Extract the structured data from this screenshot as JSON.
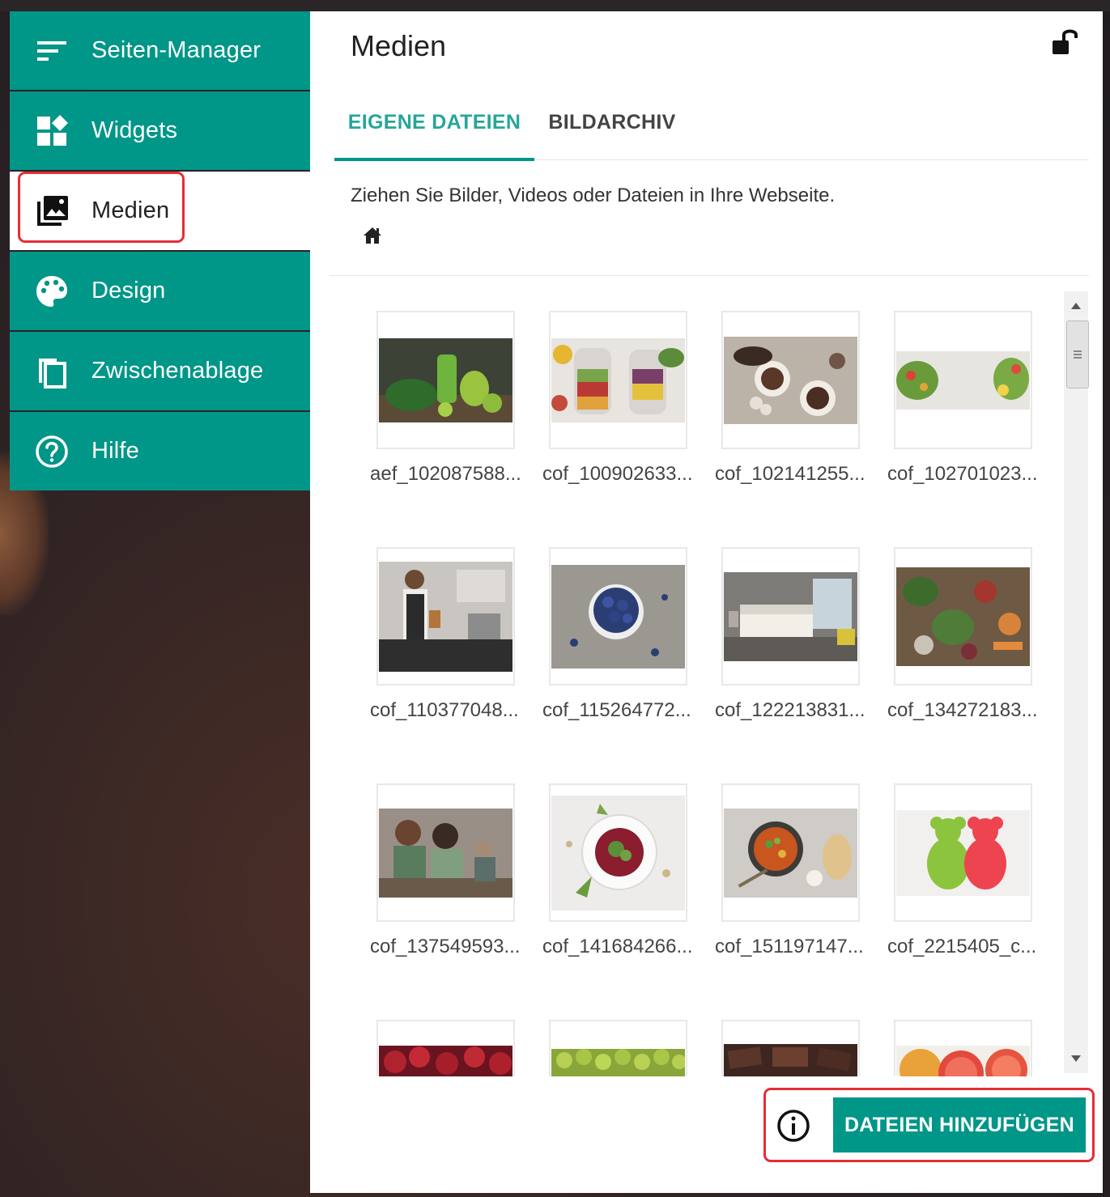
{
  "sidebar": {
    "items": [
      {
        "label": "Seiten-Manager",
        "icon": "sort-lines-icon"
      },
      {
        "label": "Widgets",
        "icon": "widgets-icon"
      },
      {
        "label": "Medien",
        "icon": "photo-library-icon",
        "active": true
      },
      {
        "label": "Design",
        "icon": "palette-icon"
      },
      {
        "label": "Zwischenablage",
        "icon": "copy-icon"
      },
      {
        "label": "Hilfe",
        "icon": "help-circle-icon"
      }
    ]
  },
  "panel": {
    "title": "Medien",
    "tabs": [
      {
        "label": "EIGENE DATEIEN",
        "active": true
      },
      {
        "label": "BILDARCHIV",
        "active": false
      }
    ],
    "hint": "Ziehen Sie Bilder, Videos oder Dateien in Ihre Webseite.",
    "add_button_label": "DATEIEN HINZUFÜGEN"
  },
  "media": [
    {
      "name": "aef_102087588..."
    },
    {
      "name": "cof_100902633..."
    },
    {
      "name": "cof_102141255..."
    },
    {
      "name": "cof_102701023..."
    },
    {
      "name": "cof_110377048..."
    },
    {
      "name": "cof_115264772..."
    },
    {
      "name": "cof_122213831..."
    },
    {
      "name": "cof_134272183..."
    },
    {
      "name": "cof_137549593..."
    },
    {
      "name": "cof_141684266..."
    },
    {
      "name": "cof_151197147..."
    },
    {
      "name": "cof_2215405_c..."
    },
    {
      "name": ""
    },
    {
      "name": ""
    },
    {
      "name": ""
    },
    {
      "name": ""
    }
  ],
  "colors": {
    "accent": "#009688",
    "accent_text": "#26a69a",
    "highlight": "#e52d35"
  }
}
